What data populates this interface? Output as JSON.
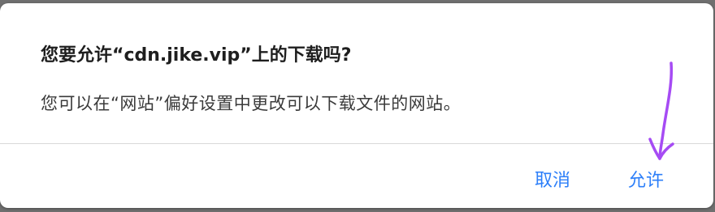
{
  "dialog": {
    "title": "您要允许“cdn.jike.vip”上的下载吗?",
    "message": "您可以在“网站”偏好设置中更改可以下载文件的网站。",
    "buttons": {
      "cancel_label": "取消",
      "allow_label": "允许"
    }
  },
  "colors": {
    "accent": "#2d7ff9",
    "annotation": "#a64bf4"
  }
}
